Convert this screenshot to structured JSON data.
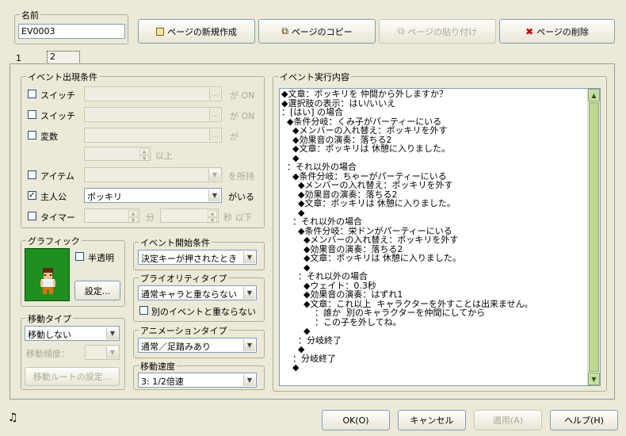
{
  "name": {
    "label": "名前",
    "value": "EV0003"
  },
  "page_buttons": {
    "new": "ページの新規作成",
    "copy": "ページのコピー",
    "paste": "ページの貼り付け",
    "delete": "ページの削除"
  },
  "tabs": [
    "1",
    "2"
  ],
  "conditions": {
    "title": "イベント出現条件",
    "switch1": "スイッチ",
    "switch1_suffix": "が ON",
    "switch2": "スイッチ",
    "switch2_suffix": "が ON",
    "variable": "変数",
    "variable_suffix": "が",
    "variable_above": "以上",
    "item": "アイテム",
    "item_suffix": "を所持",
    "actor": "主人公",
    "actor_value": "ポッキリ",
    "actor_suffix": "がいる",
    "actor_checked": true,
    "timer": "タイマー",
    "timer_min": "分",
    "timer_sec": "秒 以下"
  },
  "graphic": {
    "title": "グラフィック",
    "translucent": "半透明",
    "settings": "設定..."
  },
  "movement": {
    "title": "移動タイプ",
    "type_value": "移動しない",
    "freq_label": "移動頻度：",
    "route_button": "移動ルートの設定..."
  },
  "trigger": {
    "title": "イベント開始条件",
    "value": "決定キーが押されたとき"
  },
  "priority": {
    "title": "プライオリティタイプ",
    "value": "通常キャラと重ならない",
    "no_overlap": "別のイベントと重ならない"
  },
  "animation": {
    "title": "アニメーションタイプ",
    "value": "通常／足踏みあり"
  },
  "speed": {
    "title": "移動速度",
    "value": "3: 1/2倍速"
  },
  "commands": {
    "title": "イベント実行内容",
    "lines": [
      "◆文章：ポッキリを 仲間から外しますか？",
      "◆選択肢の表示：はい/いいえ",
      "：[はい] の場合",
      "  ◆条件分岐：くみ子がパーティーにいる",
      "    ◆メンバーの入れ替え：ポッキリを外す",
      "    ◆効果音の演奏：落ちる2",
      "    ◆文章：ポッキリは 休憩に入りました。",
      "    ◆",
      "  ：それ以外の場合",
      "    ◆条件分岐：ちゃーがパーティーにいる",
      "      ◆メンバーの入れ替え：ポッキリを外す",
      "      ◆効果音の演奏：落ちる2",
      "      ◆文章：ポッキリは 休憩に入りました。",
      "      ◆",
      "    ：それ以外の場合",
      "      ◆条件分岐：栄ドンがパーティーにいる",
      "        ◆メンバーの入れ替え：ポッキリを外す",
      "        ◆効果音の演奏：落ちる2",
      "        ◆文章：ポッキリは 休憩に入りました。",
      "        ◆",
      "      ：それ以外の場合",
      "        ◆ウェイト：0.3秒",
      "        ◆効果音の演奏：はずれ1",
      "        ◆文章：これ以上  キャラクターを外すことは出来ません。",
      "            ：誰か  別のキャラクターを仲間にしてから",
      "            ：この子を外してね。",
      "        ◆",
      "      ：分岐終了",
      "      ◆",
      "    ：分岐終了",
      "    ◆"
    ]
  },
  "footer": {
    "ok": "OK(O)",
    "cancel": "キャンセル",
    "apply": "適用(A)",
    "help": "ヘルプ(H)"
  },
  "icons": {
    "music": "music-note-icon"
  }
}
